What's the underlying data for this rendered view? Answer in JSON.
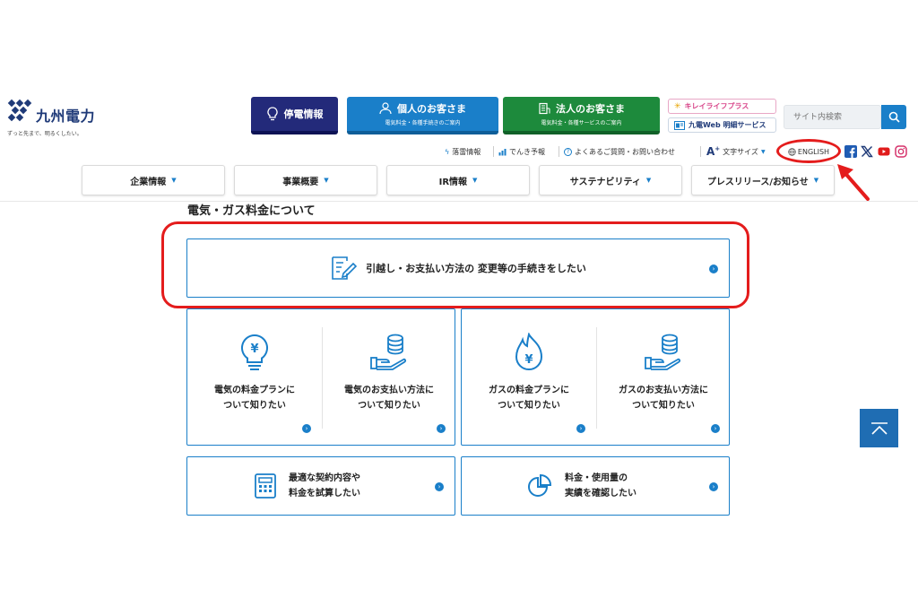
{
  "brand": {
    "name": "九州電力",
    "tagline": "ずっと先まで、明るくしたい。"
  },
  "header": {
    "outage_label": "停電情報",
    "personal": {
      "title": "個人のお客さま",
      "subtitle": "電気料金・各種手続きのご案内"
    },
    "corporate": {
      "title": "法人のお客さま",
      "subtitle": "電気料金・各種サービスのご案内"
    },
    "kirei_label": "キレイライフプラス",
    "web_label": "九電Web 明細サービス",
    "search_placeholder": "サイト内検索"
  },
  "utility": {
    "lightning": "落雷情報",
    "forecast": "でんき予報",
    "faq": "よくあるご質問・お問い合わせ",
    "font_size_prefix": "A",
    "font_size_suffix": "+",
    "font_size": "文字サイズ",
    "english": "ENGLISH"
  },
  "nav": {
    "items": [
      {
        "label": "企業情報"
      },
      {
        "label": "事業概要"
      },
      {
        "label": "IR情報"
      },
      {
        "label": "サステナビリティ"
      },
      {
        "label": "プレスリリース/お知らせ"
      }
    ]
  },
  "main": {
    "section_title": "電気・ガス料金について",
    "move_card_label": "引越し・お支払い方法の 変更等の手続きをしたい",
    "electric_plan": "電気の料金プランについて知りたい",
    "electric_plan_l1": "電気の料金プランに",
    "electric_plan_l2": "ついて知りたい",
    "electric_pay_l1": "電気のお支払い方法に",
    "electric_pay_l2": "ついて知りたい",
    "gas_plan_l1": "ガスの料金プランに",
    "gas_plan_l2": "ついて知りたい",
    "gas_pay_l1": "ガスのお支払い方法に",
    "gas_pay_l2": "ついて知りたい",
    "contract_l1": "最適な契約内容や",
    "contract_l2": "料金を試算したい",
    "usage_l1": "料金・使用量の",
    "usage_l2": "実績を確認したい"
  },
  "colors": {
    "accent": "#1a7fc9",
    "outage": "#232a7a",
    "personal": "#1a7fc9",
    "corporate": "#1d8a3c",
    "annotation": "#e41c1c"
  }
}
